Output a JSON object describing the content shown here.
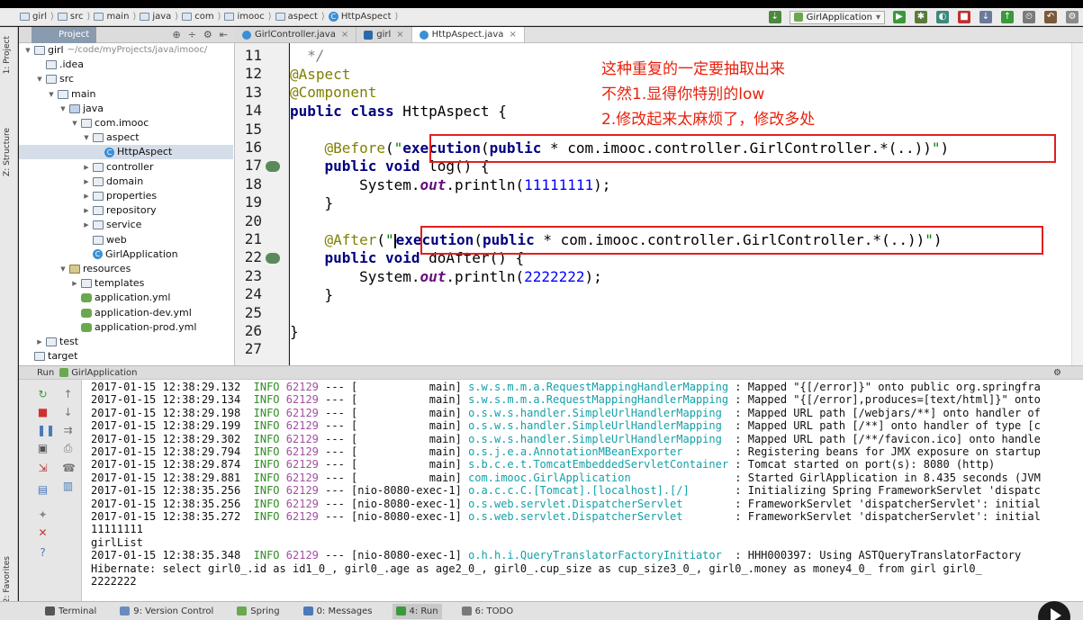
{
  "breadcrumb": [
    "girl",
    "src",
    "main",
    "java",
    "com",
    "imooc",
    "aspect",
    "HttpAspect"
  ],
  "toolbar": {
    "run_config": "GirlApplication"
  },
  "sidebar": {
    "project_tab": "1: Project",
    "structure_tab": "Z: Structure",
    "favorites_tab": "2: Favorites"
  },
  "project_panel": {
    "title": "Project",
    "tree": [
      {
        "label": "girl",
        "sub": "~/code/myProjects/java/imooc/",
        "indent": 0,
        "kind": "folder",
        "toggle": "▼"
      },
      {
        "label": ".idea",
        "indent": 1,
        "kind": "folder",
        "toggle": ""
      },
      {
        "label": "src",
        "indent": 1,
        "kind": "folder",
        "toggle": "▼"
      },
      {
        "label": "main",
        "indent": 2,
        "kind": "folder",
        "toggle": "▼"
      },
      {
        "label": "java",
        "indent": 3,
        "kind": "src",
        "toggle": "▼"
      },
      {
        "label": "com.imooc",
        "indent": 4,
        "kind": "folder",
        "toggle": "▼"
      },
      {
        "label": "aspect",
        "indent": 5,
        "kind": "folder",
        "toggle": "▼"
      },
      {
        "label": "HttpAspect",
        "indent": 6,
        "kind": "class",
        "toggle": "",
        "selected": true
      },
      {
        "label": "controller",
        "indent": 5,
        "kind": "folder",
        "toggle": "▶"
      },
      {
        "label": "domain",
        "indent": 5,
        "kind": "folder",
        "toggle": "▶"
      },
      {
        "label": "properties",
        "indent": 5,
        "kind": "folder",
        "toggle": "▶"
      },
      {
        "label": "repository",
        "indent": 5,
        "kind": "folder",
        "toggle": "▶"
      },
      {
        "label": "service",
        "indent": 5,
        "kind": "folder",
        "toggle": "▶"
      },
      {
        "label": "web",
        "indent": 5,
        "kind": "folder",
        "toggle": ""
      },
      {
        "label": "GirlApplication",
        "indent": 5,
        "kind": "class",
        "toggle": ""
      },
      {
        "label": "resources",
        "indent": 3,
        "kind": "res",
        "toggle": "▼"
      },
      {
        "label": "templates",
        "indent": 4,
        "kind": "folder",
        "toggle": "▶"
      },
      {
        "label": "application.yml",
        "indent": 4,
        "kind": "yml",
        "toggle": ""
      },
      {
        "label": "application-dev.yml",
        "indent": 4,
        "kind": "yml",
        "toggle": ""
      },
      {
        "label": "application-prod.yml",
        "indent": 4,
        "kind": "yml",
        "toggle": ""
      },
      {
        "label": "test",
        "indent": 1,
        "kind": "folder",
        "toggle": "▶"
      },
      {
        "label": "target",
        "indent": 0,
        "kind": "folder",
        "toggle": ""
      }
    ]
  },
  "editor": {
    "tabs": [
      {
        "label": "GirlController.java",
        "active": false
      },
      {
        "label": "girl",
        "active": false
      },
      {
        "label": "HttpAspect.java",
        "active": true
      }
    ],
    "line_numbers": [
      "11",
      "12",
      "13",
      "14",
      "15",
      "16",
      "17",
      "18",
      "19",
      "20",
      "21",
      "22",
      "23",
      "24",
      "25",
      "26",
      "27"
    ],
    "annotation_note": [
      "这种重复的一定要抽取出来",
      "不然1.显得你特别的low",
      "2.修改起来太麻烦了，修改多处"
    ]
  },
  "run_panel": {
    "title": "Run",
    "config": "GirlApplication",
    "lines": [
      {
        "ts": "2017-01-15 12:38:29.132",
        "lvl": "INFO",
        "pid": "62129",
        "thread": "--- [           main]",
        "logger": "s.w.s.m.m.a.RequestMappingHandlerMapping",
        "msg": " : Mapped \"{[/error]}\" onto public org.springfra"
      },
      {
        "ts": "2017-01-15 12:38:29.134",
        "lvl": "INFO",
        "pid": "62129",
        "thread": "--- [           main]",
        "logger": "s.w.s.m.m.a.RequestMappingHandlerMapping",
        "msg": " : Mapped \"{[/error],produces=[text/html]}\" onto"
      },
      {
        "ts": "2017-01-15 12:38:29.198",
        "lvl": "INFO",
        "pid": "62129",
        "thread": "--- [           main]",
        "logger": "o.s.w.s.handler.SimpleUrlHandlerMapping ",
        "msg": " : Mapped URL path [/webjars/**] onto handler of"
      },
      {
        "ts": "2017-01-15 12:38:29.199",
        "lvl": "INFO",
        "pid": "62129",
        "thread": "--- [           main]",
        "logger": "o.s.w.s.handler.SimpleUrlHandlerMapping ",
        "msg": " : Mapped URL path [/**] onto handler of type [c"
      },
      {
        "ts": "2017-01-15 12:38:29.302",
        "lvl": "INFO",
        "pid": "62129",
        "thread": "--- [           main]",
        "logger": "o.s.w.s.handler.SimpleUrlHandlerMapping ",
        "msg": " : Mapped URL path [/**/favicon.ico] onto handle"
      },
      {
        "ts": "2017-01-15 12:38:29.794",
        "lvl": "INFO",
        "pid": "62129",
        "thread": "--- [           main]",
        "logger": "o.s.j.e.a.AnnotationMBeanExporter       ",
        "msg": " : Registering beans for JMX exposure on startup"
      },
      {
        "ts": "2017-01-15 12:38:29.874",
        "lvl": "INFO",
        "pid": "62129",
        "thread": "--- [           main]",
        "logger": "s.b.c.e.t.TomcatEmbeddedServletContainer",
        "msg": " : Tomcat started on port(s): 8080 (http)"
      },
      {
        "ts": "2017-01-15 12:38:29.881",
        "lvl": "INFO",
        "pid": "62129",
        "thread": "--- [           main]",
        "logger": "com.imooc.GirlApplication               ",
        "msg": " : Started GirlApplication in 8.435 seconds (JVM"
      },
      {
        "ts": "2017-01-15 12:38:35.256",
        "lvl": "INFO",
        "pid": "62129",
        "thread": "--- [nio-8080-exec-1]",
        "logger": "o.a.c.c.C.[Tomcat].[localhost].[/]      ",
        "msg": " : Initializing Spring FrameworkServlet 'dispatc"
      },
      {
        "ts": "2017-01-15 12:38:35.256",
        "lvl": "INFO",
        "pid": "62129",
        "thread": "--- [nio-8080-exec-1]",
        "logger": "o.s.web.servlet.DispatcherServlet       ",
        "msg": " : FrameworkServlet 'dispatcherServlet': initial"
      },
      {
        "ts": "2017-01-15 12:38:35.272",
        "lvl": "INFO",
        "pid": "62129",
        "thread": "--- [nio-8080-exec-1]",
        "logger": "o.s.web.servlet.DispatcherServlet       ",
        "msg": " : FrameworkServlet 'dispatcherServlet': initial"
      },
      {
        "plain": "11111111"
      },
      {
        "plain": "girlList"
      },
      {
        "ts": "2017-01-15 12:38:35.348",
        "lvl": "INFO",
        "pid": "62129",
        "thread": "--- [nio-8080-exec-1]",
        "logger": "o.h.h.i.QueryTranslatorFactoryInitiator ",
        "msg": " : HHH000397: Using ASTQueryTranslatorFactory"
      },
      {
        "plain": "Hibernate: select girl0_.id as id1_0_, girl0_.age as age2_0_, girl0_.cup_size as cup_size3_0_, girl0_.money as money4_0_ from girl girl0_"
      },
      {
        "plain": "2222222"
      }
    ]
  },
  "bottom_tabs": [
    {
      "label": "Terminal",
      "color": "#555555"
    },
    {
      "label": "9: Version Control",
      "color": "#6a8cbd"
    },
    {
      "label": "Spring",
      "color": "#6aa84f"
    },
    {
      "label": "0: Messages",
      "color": "#4a7ab8"
    },
    {
      "label": "4: Run",
      "color": "#3a9a3a",
      "active": true
    },
    {
      "label": "6: TODO",
      "color": "#7a7a7a"
    }
  ]
}
